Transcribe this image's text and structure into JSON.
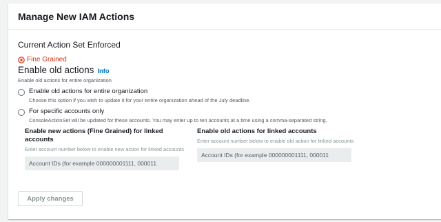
{
  "panel": {
    "title": "Manage New IAM Actions"
  },
  "current": {
    "section_title": "Current Action Set Enforced",
    "status_text": "Fine Grained",
    "status_color": "#d13212"
  },
  "field": {
    "label": "Enable old actions",
    "info": "Info",
    "description": "Enable old actions for entire organization"
  },
  "options": [
    {
      "label": "Enable old actions for entire organization",
      "description": "Choose this option if you wish to update it for your entire organization ahead of the July deadline.",
      "selected": false
    },
    {
      "label": "For specific accounts only",
      "description": "ConsoleActionSet will be updated for these accounts. You may enter up to ten accounts at a time using a comma-separated string.",
      "selected": false
    }
  ],
  "new_actions": {
    "title": "Enable new actions (Fine Grained) for linked accounts",
    "description": "Enter account number below to enable new action for linked accounts",
    "placeholder": "Account IDs (for example 000000001111, 000011"
  },
  "old_actions": {
    "title": "Enable old actions for linked accounts",
    "description": "Enter account number below to enable old action for linked accounts",
    "placeholder": "Account IDs (for example 000000001111, 000011"
  },
  "apply_button": "Apply changes",
  "colors": {
    "link": "#0073bb",
    "error": "#d13212",
    "disabled_input": "#eaeded"
  }
}
